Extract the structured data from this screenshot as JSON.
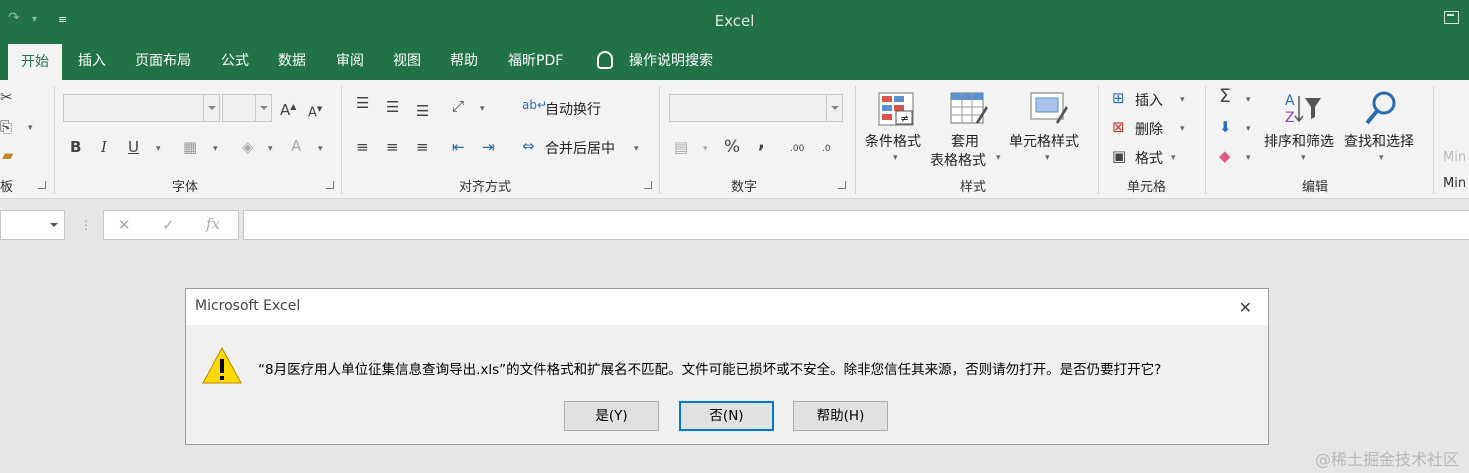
{
  "window": {
    "title": "Excel"
  },
  "tabs": [
    {
      "label": "开始",
      "active": true
    },
    {
      "label": "插入"
    },
    {
      "label": "页面布局"
    },
    {
      "label": "公式"
    },
    {
      "label": "数据"
    },
    {
      "label": "审阅"
    },
    {
      "label": "视图"
    },
    {
      "label": "帮助"
    },
    {
      "label": "福昕PDF"
    }
  ],
  "tell_me": "操作说明搜索",
  "ribbon": {
    "clipboard_label_fragment": "板",
    "font_label": "字体",
    "font_buttons": [
      "B",
      "I",
      "U",
      "A"
    ],
    "align_label": "对齐方式",
    "wrap_text": "自动换行",
    "merge_center": "合并后居中",
    "number_label": "数字",
    "percent": "%",
    "comma": ",",
    "inc_decimal": ".00",
    "dec_decimal": ".0",
    "styles_label": "样式",
    "cond_format": "条件格式",
    "table_format_1": "套用",
    "table_format_2": "表格格式",
    "cell_styles": "单元格样式",
    "cells_label": "单元格",
    "insert": "插入",
    "delete": "删除",
    "format": "格式",
    "edit_label": "编辑",
    "sort_filter": "排序和筛选",
    "find_select": "查找和选择",
    "min_fragment": "Min",
    "min_label_fragment": "Min"
  },
  "formula_bar": {
    "fx": "fx"
  },
  "dialog": {
    "title": "Microsoft Excel",
    "message": "“8月医疗用人单位征集信息查询导出.xls”的文件格式和扩展名不匹配。文件可能已损坏或不安全。除非您信任其来源，否则请勿打开。是否仍要打开它?",
    "buttons": {
      "yes": "是(Y)",
      "no": "否(N)",
      "help": "帮助(H)"
    }
  },
  "watermark": "@稀土掘金技术社区",
  "colors": {
    "brand": "#217346",
    "dialog_default_border": "#0078d7",
    "warning": "#ffd800"
  }
}
